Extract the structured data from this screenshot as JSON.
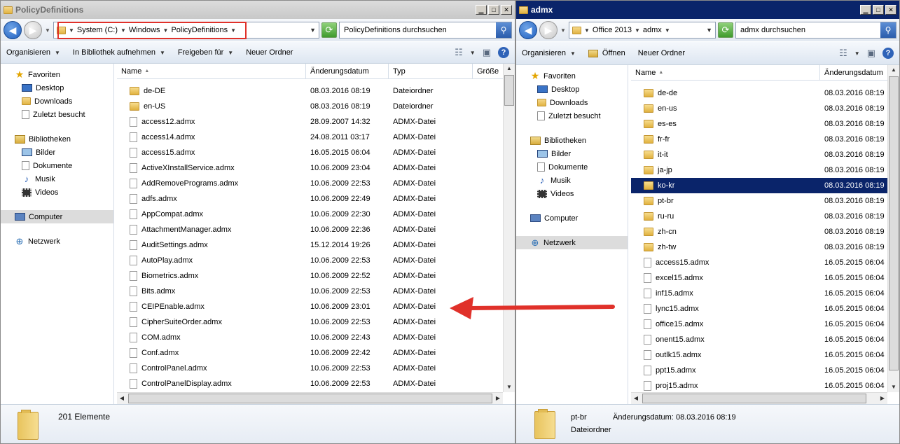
{
  "left": {
    "title": "PolicyDefinitions",
    "breadcrumb": [
      "System (C:)",
      "Windows",
      "PolicyDefinitions"
    ],
    "search_placeholder": "PolicyDefinitions durchsuchen",
    "toolbar": [
      "Organisieren",
      "In Bibliothek aufnehmen",
      "Freigeben für",
      "Neuer Ordner"
    ],
    "toolbar_dropdown": [
      true,
      true,
      true,
      false
    ],
    "nav": {
      "favorites": "Favoriten",
      "fav_items": [
        "Desktop",
        "Downloads",
        "Zuletzt besucht"
      ],
      "libraries": "Bibliotheken",
      "lib_items": [
        "Bilder",
        "Dokumente",
        "Musik",
        "Videos"
      ],
      "computer": "Computer",
      "network": "Netzwerk"
    },
    "columns": [
      "Name",
      "Änderungsdatum",
      "Typ",
      "Größe"
    ],
    "files": [
      {
        "name": "de-DE",
        "date": "08.03.2016 08:19",
        "type": "Dateiordner",
        "folder": true
      },
      {
        "name": "en-US",
        "date": "08.03.2016 08:19",
        "type": "Dateiordner",
        "folder": true
      },
      {
        "name": "access12.admx",
        "date": "28.09.2007 14:32",
        "type": "ADMX-Datei",
        "folder": false
      },
      {
        "name": "access14.admx",
        "date": "24.08.2011 03:17",
        "type": "ADMX-Datei",
        "folder": false
      },
      {
        "name": "access15.admx",
        "date": "16.05.2015 06:04",
        "type": "ADMX-Datei",
        "folder": false
      },
      {
        "name": "ActiveXInstallService.admx",
        "date": "10.06.2009 23:04",
        "type": "ADMX-Datei",
        "folder": false
      },
      {
        "name": "AddRemovePrograms.admx",
        "date": "10.06.2009 22:53",
        "type": "ADMX-Datei",
        "folder": false
      },
      {
        "name": "adfs.admx",
        "date": "10.06.2009 22:49",
        "type": "ADMX-Datei",
        "folder": false
      },
      {
        "name": "AppCompat.admx",
        "date": "10.06.2009 22:30",
        "type": "ADMX-Datei",
        "folder": false
      },
      {
        "name": "AttachmentManager.admx",
        "date": "10.06.2009 22:36",
        "type": "ADMX-Datei",
        "folder": false
      },
      {
        "name": "AuditSettings.admx",
        "date": "15.12.2014 19:26",
        "type": "ADMX-Datei",
        "folder": false
      },
      {
        "name": "AutoPlay.admx",
        "date": "10.06.2009 22:53",
        "type": "ADMX-Datei",
        "folder": false
      },
      {
        "name": "Biometrics.admx",
        "date": "10.06.2009 22:52",
        "type": "ADMX-Datei",
        "folder": false
      },
      {
        "name": "Bits.admx",
        "date": "10.06.2009 22:53",
        "type": "ADMX-Datei",
        "folder": false
      },
      {
        "name": "CEIPEnable.admx",
        "date": "10.06.2009 23:01",
        "type": "ADMX-Datei",
        "folder": false
      },
      {
        "name": "CipherSuiteOrder.admx",
        "date": "10.06.2009 22:53",
        "type": "ADMX-Datei",
        "folder": false
      },
      {
        "name": "COM.admx",
        "date": "10.06.2009 22:43",
        "type": "ADMX-Datei",
        "folder": false
      },
      {
        "name": "Conf.admx",
        "date": "10.06.2009 22:42",
        "type": "ADMX-Datei",
        "folder": false
      },
      {
        "name": "ControlPanel.admx",
        "date": "10.06.2009 22:53",
        "type": "ADMX-Datei",
        "folder": false
      },
      {
        "name": "ControlPanelDisplay.admx",
        "date": "10.06.2009 22:53",
        "type": "ADMX-Datei",
        "folder": false
      }
    ],
    "status": "201 Elemente"
  },
  "right": {
    "title": "admx",
    "breadcrumb": [
      "Office 2013",
      "admx"
    ],
    "search_placeholder": "admx durchsuchen",
    "toolbar": [
      "Organisieren",
      "Öffnen",
      "Neuer Ordner"
    ],
    "toolbar_dropdown": [
      true,
      false,
      false
    ],
    "nav": {
      "favorites": "Favoriten",
      "fav_items": [
        "Desktop",
        "Downloads",
        "Zuletzt besucht"
      ],
      "libraries": "Bibliotheken",
      "lib_items": [
        "Bilder",
        "Dokumente",
        "Musik",
        "Videos"
      ],
      "computer": "Computer",
      "network": "Netzwerk"
    },
    "columns": [
      "Name",
      "Änderungsdatum"
    ],
    "selected_index": 6,
    "files": [
      {
        "name": "de-de",
        "date": "08.03.2016 08:19",
        "folder": true
      },
      {
        "name": "en-us",
        "date": "08.03.2016 08:19",
        "folder": true
      },
      {
        "name": "es-es",
        "date": "08.03.2016 08:19",
        "folder": true
      },
      {
        "name": "fr-fr",
        "date": "08.03.2016 08:19",
        "folder": true
      },
      {
        "name": "it-it",
        "date": "08.03.2016 08:19",
        "folder": true
      },
      {
        "name": "ja-jp",
        "date": "08.03.2016 08:19",
        "folder": true
      },
      {
        "name": "ko-kr",
        "date": "08.03.2016 08:19",
        "folder": true
      },
      {
        "name": "pt-br",
        "date": "08.03.2016 08:19",
        "folder": true
      },
      {
        "name": "ru-ru",
        "date": "08.03.2016 08:19",
        "folder": true
      },
      {
        "name": "zh-cn",
        "date": "08.03.2016 08:19",
        "folder": true
      },
      {
        "name": "zh-tw",
        "date": "08.03.2016 08:19",
        "folder": true
      },
      {
        "name": "access15.admx",
        "date": "16.05.2015 06:04",
        "folder": false
      },
      {
        "name": "excel15.admx",
        "date": "16.05.2015 06:04",
        "folder": false
      },
      {
        "name": "inf15.admx",
        "date": "16.05.2015 06:04",
        "folder": false
      },
      {
        "name": "lync15.admx",
        "date": "16.05.2015 06:04",
        "folder": false
      },
      {
        "name": "office15.admx",
        "date": "16.05.2015 06:04",
        "folder": false
      },
      {
        "name": "onent15.admx",
        "date": "16.05.2015 06:04",
        "folder": false
      },
      {
        "name": "outlk15.admx",
        "date": "16.05.2015 06:04",
        "folder": false
      },
      {
        "name": "ppt15.admx",
        "date": "16.05.2015 06:04",
        "folder": false
      },
      {
        "name": "proj15.admx",
        "date": "16.05.2015 06:04",
        "folder": false
      }
    ],
    "details": {
      "name": "pt-br",
      "date_label": "Änderungsdatum:",
      "date_value": "08.03.2016 08:19",
      "type": "Dateiordner"
    }
  },
  "colors": {
    "selection": "#0a246a",
    "annotation_red": "#e0312a",
    "active_title": "#0a246a"
  },
  "icons": {
    "minimize": "minimize-icon",
    "maximize": "maximize-icon",
    "close": "close-icon",
    "back": "back-arrow-icon",
    "forward": "forward-arrow-icon",
    "refresh": "refresh-icon",
    "search": "search-icon",
    "help": "help-icon"
  }
}
